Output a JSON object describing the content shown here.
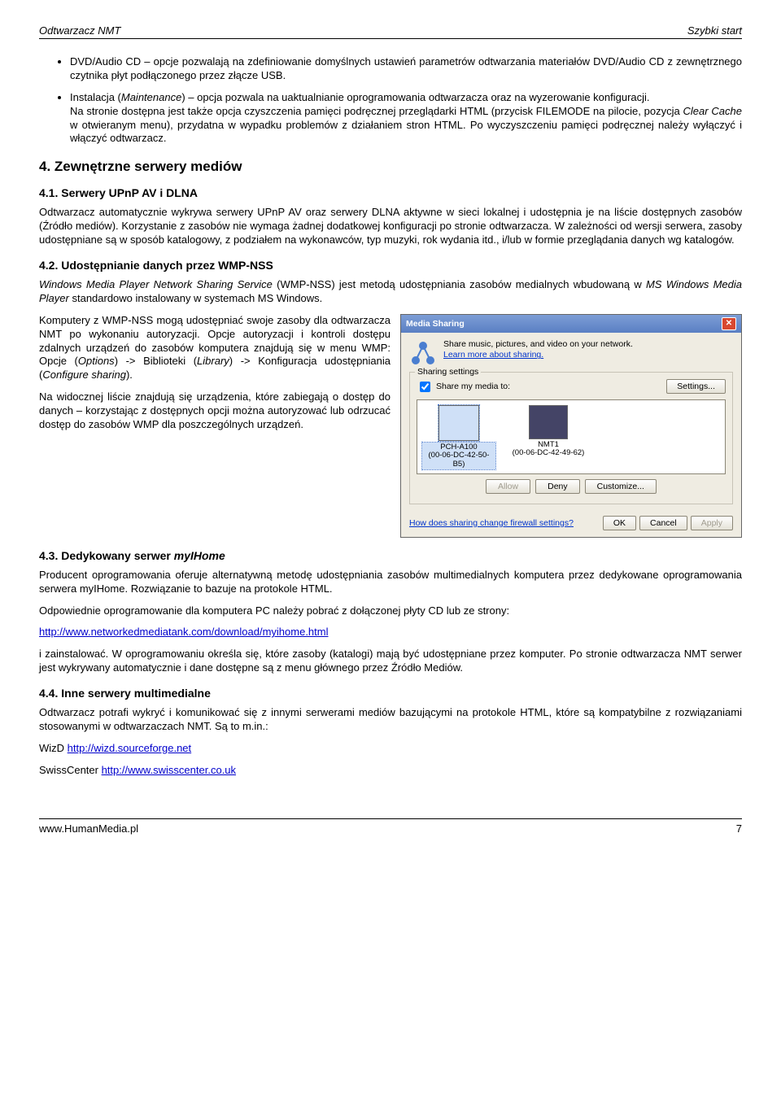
{
  "header": {
    "left": "Odtwarzacz NMT",
    "right": "Szybki start"
  },
  "bullets": {
    "b1": "DVD/Audio CD – opcje pozwalają na zdefiniowanie domyślnych ustawień parametrów odtwarzania materiałów DVD/Audio CD z zewnętrznego czytnika płyt podłączonego przez złącze USB.",
    "b2_a": "Instalacja (",
    "b2_i": "Maintenance",
    "b2_b": ") – opcja pozwala na uaktualnianie oprogramowania odtwarzacza oraz na wyzerowanie konfiguracji.",
    "b2_c": "Na stronie dostępna jest także opcja czyszczenia pamięci podręcznej przeglądarki HTML (przycisk FILEMODE na pilocie, pozycja ",
    "b2_i2": "Clear Cache",
    "b2_d": " w otwieranym menu), przydatna w wypadku problemów z działaniem stron HTML. Po wyczyszczeniu pamięci podręcznej należy wyłączyć i włączyć odtwarzacz."
  },
  "h2_4": "4.  Zewnętrzne serwery mediów",
  "h3_41": "4.1.  Serwery UPnP AV i DLNA",
  "p41": "Odtwarzacz automatycznie wykrywa serwery UPnP AV oraz serwery DLNA aktywne w sieci lokalnej i udostępnia je na liście dostępnych zasobów (Źródło mediów). Korzystanie z zasobów nie wymaga żadnej dodatkowej konfiguracji po stronie odtwarzacza. W zależności od wersji serwera, zasoby udostępniane są w sposób katalogowy, z podziałem na wykonawców, typ muzyki, rok wydania itd., i/lub w formie przeglądania danych wg katalogów.",
  "h3_42": "4.2.  Udostępnianie danych przez WMP-NSS",
  "p42_a": "Windows Media Player Network Sharing Service",
  "p42_b": " (WMP-NSS) jest metodą udostępniania zasobów medialnych wbudowaną w ",
  "p42_c": "MS Windows Media Player",
  "p42_d": " standardowo instalowany w systemach MS Windows.",
  "p42_left_a": "Komputery z WMP-NSS mogą udostępniać swoje zasoby dla odtwarzacza NMT po wykonaniu autoryzacji. Opcje autoryzacji i kontroli dostępu zdalnych urządzeń do zasobów komputera znajdują się w menu WMP: Opcje (",
  "p42_left_i1": "Options",
  "p42_left_b": ") -> Biblioteki (",
  "p42_left_i2": "Library",
  "p42_left_c": ") -> Konfiguracja udostępniania (",
  "p42_left_i3": "Configure sharing",
  "p42_left_d": ").",
  "p42_left2": "Na widocznej liście znajdują się urządzenia, które zabiegają o dostęp do danych – korzystając z dostępnych opcji można autoryzować lub odrzucać dostęp do zasobów WMP dla poszczególnych urządzeń.",
  "dialog": {
    "title": "Media Sharing",
    "desc1": "Share music, pictures, and video on your network.",
    "desc_link": "Learn more about sharing.",
    "section_legend": "Sharing settings",
    "share_label": "Share my media to:",
    "settings_btn": "Settings...",
    "dev1_name": "PCH-A100",
    "dev1_mac": "(00-06-DC-42-50-B5)",
    "dev2_name": "NMT1",
    "dev2_mac": "(00-06-DC-42-49-62)",
    "allow": "Allow",
    "deny": "Deny",
    "customize": "Customize...",
    "footer_link": "How does sharing change firewall settings?",
    "ok": "OK",
    "cancel": "Cancel",
    "apply": "Apply"
  },
  "h3_43": "4.3.  Dedykowany serwer myIHome",
  "p43_a": "Producent oprogramowania oferuje alternatywną metodę udostępniania zasobów multimedialnych komputera przez dedykowane oprogramowania serwera myIHome. Rozwiązanie to bazuje na protokole HTML.",
  "p43_b": "Odpowiednie oprogramowanie dla komputera PC należy pobrać z dołączonej płyty CD lub ze strony:",
  "p43_link": "http://www.networkedmediatank.com/download/myihome.html",
  "p43_c": "i zainstalować. W oprogramowaniu określa się, które zasoby (katalogi) mają być udostępniane przez komputer. Po stronie odtwarzacza NMT serwer jest wykrywany automatycznie i dane dostępne są z menu głównego przez Źródło Mediów.",
  "h3_44": "4.4.  Inne serwery multimedialne",
  "p44_a": "Odtwarzacz potrafi wykryć i komunikować się z innymi serwerami mediów bazującymi na protokole HTML, które są kompatybilne z rozwiązaniami stosowanymi w odtwarzaczach NMT. Są to m.in.:",
  "p44_wizd_label": "WizD ",
  "p44_wizd_link": "http://wizd.sourceforge.net",
  "p44_sc_label": "SwissCenter ",
  "p44_sc_link": "http://www.swisscenter.co.uk",
  "footer": {
    "left": "www.HumanMedia.pl",
    "right": "7"
  }
}
